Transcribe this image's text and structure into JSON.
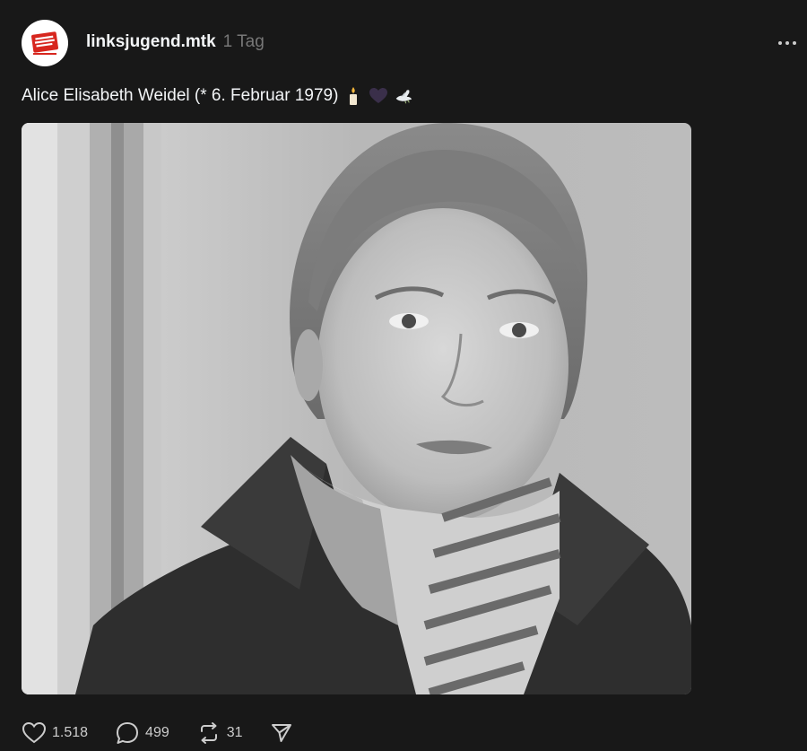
{
  "post": {
    "username": "linksjugend.mtk",
    "timestamp": "1 Tag",
    "avatar_logo_text": "links jugend [solid]",
    "caption_text": "Alice Elisabeth Weidel (* 6. Februar 1979)",
    "caption_emojis": [
      "candle-icon",
      "black-heart-icon",
      "dove-icon"
    ],
    "image_icon": "portrait-photo"
  },
  "actions": {
    "likes": "1.518",
    "comments": "499",
    "reposts": "31",
    "like_icon": "heart-icon",
    "comment_icon": "comment-bubble-icon",
    "repost_icon": "repost-icon",
    "share_icon": "send-icon"
  },
  "colors": {
    "background": "#181818",
    "text_primary": "#f3f5f7",
    "text_secondary": "#777777",
    "avatar_red": "#d7261e"
  }
}
